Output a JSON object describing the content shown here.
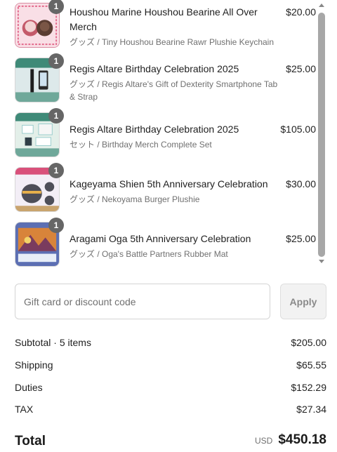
{
  "cart": {
    "items": [
      {
        "qty": "1",
        "title": "Houshou Marine Houshou Bearine All Over Merch",
        "subtitle": "グッズ / Tiny Houshou Bearine Rawr Plushie Keychain",
        "price": "$20.00"
      },
      {
        "qty": "1",
        "title": "Regis Altare Birthday Celebration 2025",
        "subtitle": "グッズ / Regis Altare's Gift of Dexterity Smartphone Tab & Strap",
        "price": "$25.00"
      },
      {
        "qty": "1",
        "title": "Regis Altare Birthday Celebration 2025",
        "subtitle": "セット / Birthday Merch Complete Set",
        "price": "$105.00"
      },
      {
        "qty": "1",
        "title": "Kageyama Shien 5th Anniversary Celebration",
        "subtitle": "グッズ / Nekoyama Burger Plushie",
        "price": "$30.00"
      },
      {
        "qty": "1",
        "title": "Aragami Oga 5th Anniversary Celebration",
        "subtitle": "グッズ / Oga's Battle Partners Rubber Mat",
        "price": "$25.00"
      }
    ]
  },
  "discount": {
    "placeholder": "Gift card or discount code",
    "apply_label": "Apply"
  },
  "summary": {
    "subtotal_label": "Subtotal · 5 items",
    "subtotal_value": "$205.00",
    "shipping_label": "Shipping",
    "shipping_value": "$65.55",
    "duties_label": "Duties",
    "duties_value": "$152.29",
    "tax_label": "TAX",
    "tax_value": "$27.34"
  },
  "total": {
    "label": "Total",
    "currency": "USD",
    "value": "$450.18"
  }
}
